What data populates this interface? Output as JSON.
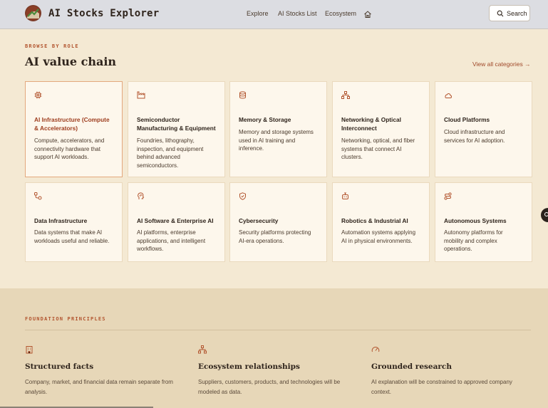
{
  "header": {
    "app_title": "AI Stocks Explorer",
    "nav": [
      "Explore",
      "AI Stocks List",
      "Ecosystem"
    ],
    "search_label": "Search"
  },
  "browse": {
    "eyebrow": "BROWSE BY ROLE",
    "title": "AI value chain",
    "view_all": "View all categories →",
    "cards": [
      {
        "icon": "chip-icon",
        "title": "AI Infrastructure (Compute & Accelerators)",
        "desc": "Compute, accelerators, and connectivity hardware that support AI workloads."
      },
      {
        "icon": "factory-icon",
        "title": "Semiconductor Manufacturing & Equipment",
        "desc": "Foundries, lithography, inspection, and equipment behind advanced semiconductors."
      },
      {
        "icon": "database-icon",
        "title": "Memory & Storage",
        "desc": "Memory and storage systems used in AI training and inference."
      },
      {
        "icon": "network-icon",
        "title": "Networking & Optical Interconnect",
        "desc": "Networking, optical, and fiber systems that connect AI clusters."
      },
      {
        "icon": "cloud-icon",
        "title": "Cloud Platforms",
        "desc": "Cloud infrastructure and services for AI adoption."
      },
      {
        "icon": "workflow-icon",
        "title": "Data Infrastructure",
        "desc": "Data systems that make AI workloads useful and reliable."
      },
      {
        "icon": "brain-icon",
        "title": "AI Software & Enterprise AI",
        "desc": "AI platforms, enterprise applications, and intelligent workflows."
      },
      {
        "icon": "shield-icon",
        "title": "Cybersecurity",
        "desc": "Security platforms protecting AI-era operations."
      },
      {
        "icon": "robot-icon",
        "title": "Robotics & Industrial AI",
        "desc": "Automation systems applying AI in physical environments."
      },
      {
        "icon": "route-icon",
        "title": "Autonomous Systems",
        "desc": "Autonomy platforms for mobility and complex operations."
      }
    ]
  },
  "foundation": {
    "eyebrow": "FOUNDATION PRINCIPLES",
    "pillars": [
      {
        "icon": "building-icon",
        "title": "Structured facts",
        "desc": "Company, market, and financial data remain separate from analysis."
      },
      {
        "icon": "network-icon",
        "title": "Ecosystem relationships",
        "desc": "Suppliers, customers, products, and technologies will be modeled as data."
      },
      {
        "icon": "gauge-icon",
        "title": "Grounded research",
        "desc": "AI explanation will be constrained to approved company context."
      }
    ]
  },
  "colors": {
    "accent": "#b2552f",
    "background": "#f4e9d3",
    "card": "#fdf7ec",
    "foundation_bg": "#e7d7b8"
  }
}
